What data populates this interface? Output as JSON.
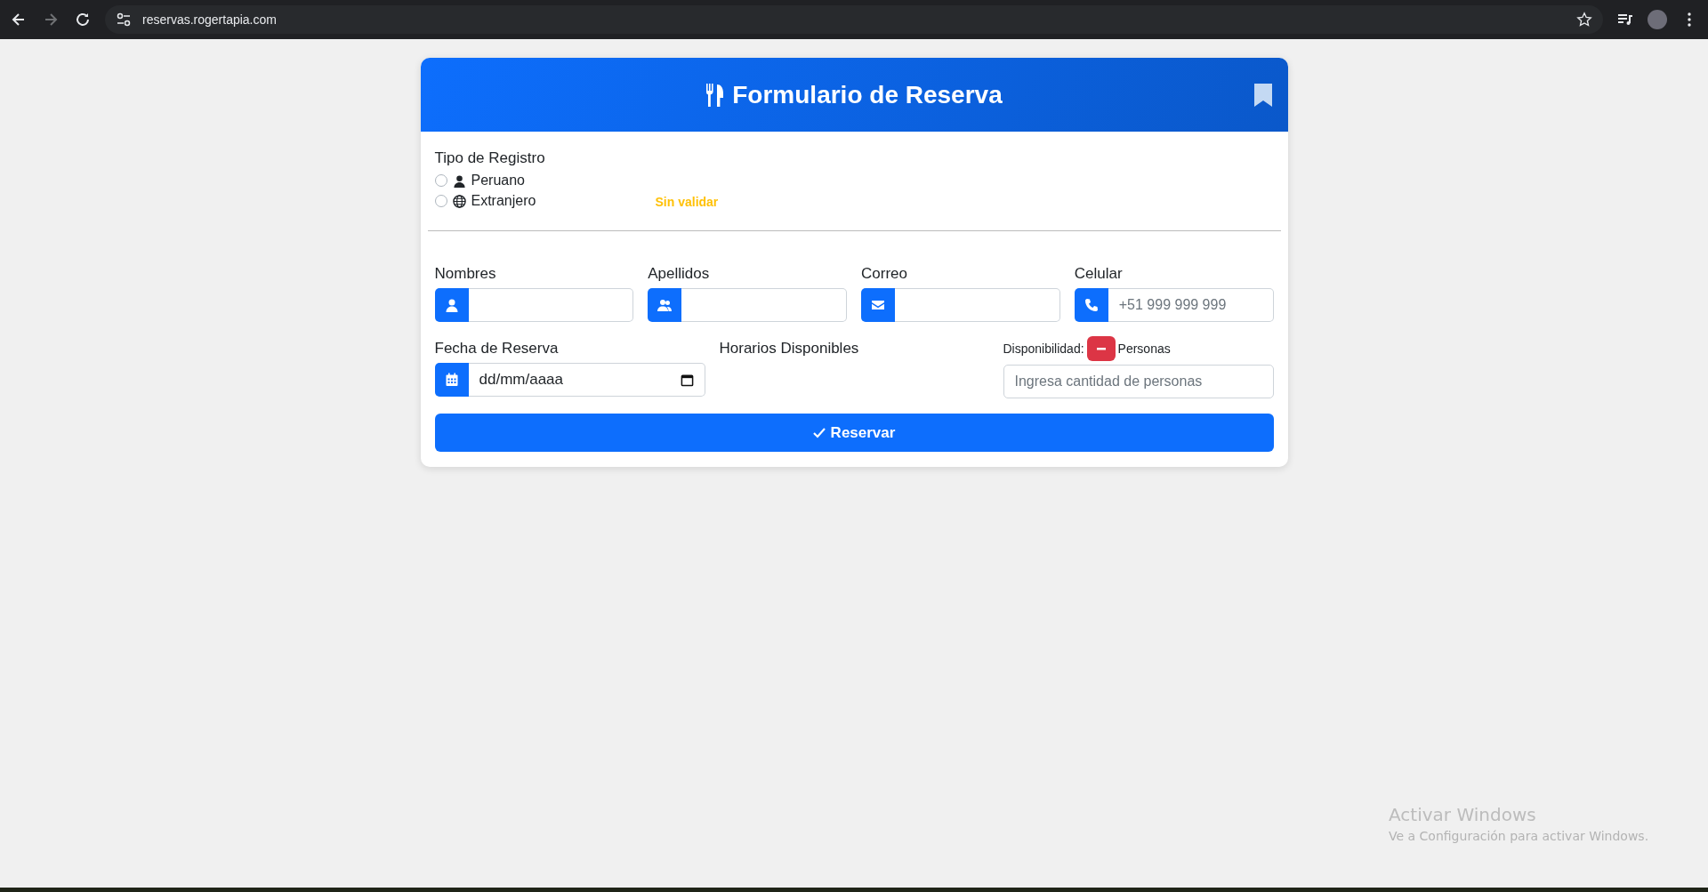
{
  "browser": {
    "url": "reservas.rogertapia.com"
  },
  "form": {
    "title": "Formulario de Reserva",
    "registro": {
      "label": "Tipo de Registro",
      "status": "Sin validar",
      "options": [
        {
          "label": "Peruano",
          "kind": "person",
          "selected": false
        },
        {
          "label": "Extranjero",
          "kind": "globe",
          "selected": false
        }
      ]
    },
    "fields": [
      {
        "label": "Nombres",
        "kind": "user"
      },
      {
        "label": "Apellidos",
        "kind": "users"
      },
      {
        "label": "Correo",
        "kind": "envelope"
      },
      {
        "label": "Celular",
        "kind": "phone",
        "placeholder": "+51 999 999 999"
      }
    ],
    "fecha": {
      "label": "Fecha de Reserva",
      "value": "dd/mm/aaaa"
    },
    "horarios": {
      "label": "Horarios Disponibles"
    },
    "disponibilidad": {
      "label": "Disponibilidad:",
      "unit": "Personas",
      "placeholder": "Ingresa cantidad de personas"
    },
    "submit": "Reservar"
  },
  "os_notice": {
    "title": "Activar Windows",
    "text": "Ve a Configuración para activar Windows."
  }
}
